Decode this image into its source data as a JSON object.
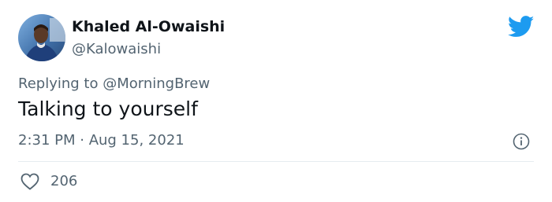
{
  "tweet": {
    "author_name": "Khaled Al-Owaishi",
    "author_handle": "@Kalowaishi",
    "reply_prefix": "Replying to ",
    "reply_to": "@MorningBrew",
    "text": "Talking to yourself",
    "timestamp": "2:31 PM · Aug 15, 2021",
    "like_count": "206"
  },
  "icons": {
    "brand": "twitter-bird-icon",
    "info": "info-icon",
    "like": "heart-icon"
  },
  "colors": {
    "brand_blue": "#1d9bf0",
    "text_primary": "#0f1419",
    "text_secondary": "#536471"
  }
}
